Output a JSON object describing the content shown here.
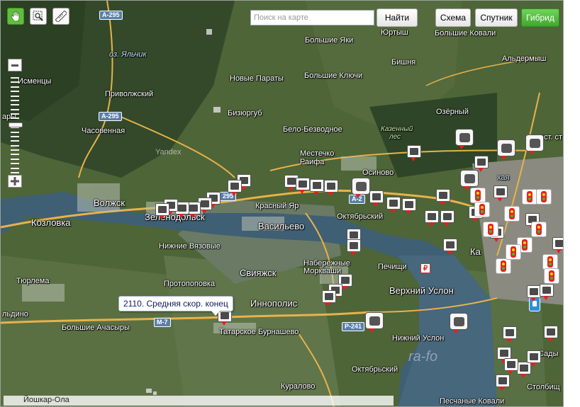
{
  "toolbar": {
    "tools": [
      {
        "name": "hand-tool",
        "icon": "hand-icon",
        "active": true
      },
      {
        "name": "magnifier-tool",
        "icon": "magnifier-icon",
        "active": false
      },
      {
        "name": "ruler-tool",
        "icon": "ruler-icon",
        "active": false
      }
    ]
  },
  "search": {
    "placeholder": "Поиск на карте",
    "value": "",
    "button_label": "Найти"
  },
  "map_types": [
    {
      "label": "Схема",
      "active": false
    },
    {
      "label": "Спутник",
      "active": false
    },
    {
      "label": "Гибрид",
      "active": true
    }
  ],
  "zoom": {
    "plus": "+",
    "minus": "−",
    "level_fraction": 0.5
  },
  "places": [
    {
      "id": "yurtysh",
      "text": "Юртыш"
    },
    {
      "id": "bolshie-kovali",
      "text": "Большие Ковали"
    },
    {
      "id": "bolshie-yaki",
      "text": "Большие Яки"
    },
    {
      "id": "bishnya",
      "text": "Бишня"
    },
    {
      "id": "aldermysh",
      "text": "Альдермыш"
    },
    {
      "id": "noviye-paraty",
      "text": "Новые Параты"
    },
    {
      "id": "bolshie-klyuchi",
      "text": "Большие Ключи"
    },
    {
      "id": "ismenzy",
      "text": "Исменцы"
    },
    {
      "id": "privolzhsky",
      "text": "Приволжский"
    },
    {
      "id": "ozyorny",
      "text": "Озёрный"
    },
    {
      "id": "bizyurgub",
      "text": "Бизюргуб"
    },
    {
      "id": "chasovennaya",
      "text": "Часовенная"
    },
    {
      "id": "belo-bezvodnoe",
      "text": "Бело-Безводное"
    },
    {
      "id": "mestechko-raifa",
      "text": "Местечко Раифа"
    },
    {
      "id": "osinovo",
      "text": "Осиново"
    },
    {
      "id": "volzhsk",
      "text": "Волжск"
    },
    {
      "id": "zelenodolsk",
      "text": "Зеленодольск"
    },
    {
      "id": "krasny-yar",
      "text": "Красный Яр"
    },
    {
      "id": "oktyabrsky",
      "text": "Октябрьский"
    },
    {
      "id": "kozlovka",
      "text": "Козловка"
    },
    {
      "id": "vasilevo",
      "text": "Васильево"
    },
    {
      "id": "nizhnie-vyazovye",
      "text": "Нижние Вязовые"
    },
    {
      "id": "naberezhnye-morkvashi",
      "text": "Набережные Моркваши"
    },
    {
      "id": "pechishi",
      "text": "Печищи"
    },
    {
      "id": "sviyazhsk",
      "text": "Свияжск"
    },
    {
      "id": "turlema",
      "text": "Тюрлема"
    },
    {
      "id": "protopopovka",
      "text": "Протопоповка"
    },
    {
      "id": "verkhny-uslon",
      "text": "Верхний Услон"
    },
    {
      "id": "innopolis",
      "text": "Иннополис"
    },
    {
      "id": "dino",
      "text": "льдино"
    },
    {
      "id": "bolshie-achasyry",
      "text": "Большие Ачасыры"
    },
    {
      "id": "tatarskoe-burnashevo",
      "text": "Татарское Бурнашево"
    },
    {
      "id": "nizhny-uslon",
      "text": "Нижний Услон"
    },
    {
      "id": "oktyabrsky-2",
      "text": "Октябрьский"
    },
    {
      "id": "kuralovo",
      "text": "Куралово"
    },
    {
      "id": "yoshkar-ola",
      "text": "Йошкар-Ола"
    },
    {
      "id": "pesochnye-kovali",
      "text": "Песчаные Ковали"
    },
    {
      "id": "stolbishe",
      "text": "Столбищ"
    },
    {
      "id": "sady",
      "text": "Сады"
    },
    {
      "id": "ost-st",
      "text": "ост. ст"
    },
    {
      "id": "ary",
      "text": "ары"
    },
    {
      "id": "kazan-k",
      "text": "Ка"
    },
    {
      "id": "ukhaya",
      "text": "хая"
    }
  ],
  "water_labels": [
    {
      "id": "yalchik",
      "text": "оз. Яльчик"
    }
  ],
  "forest_labels": [
    {
      "id": "kazenny-les",
      "text": "Казенный лес"
    }
  ],
  "road_shields": [
    {
      "id": "a295-top",
      "text": "А-295"
    },
    {
      "id": "a295-mid",
      "text": "А-295"
    },
    {
      "id": "r295",
      "text": "295"
    },
    {
      "id": "a-east",
      "text": "А-2"
    },
    {
      "id": "m7",
      "text": "М-7"
    },
    {
      "id": "r241",
      "text": "Р-241"
    }
  ],
  "watermarks": {
    "yandex": "Yandex",
    "site": "ra-fo"
  },
  "tooltip": {
    "text": "2110. Средняя скор. конец"
  },
  "metro_symbol": "₽",
  "colors": {
    "hybrid_active": "#4cb83a",
    "camera_arrow": "#e32020",
    "water": "#3f5f74",
    "road": "#e8b24a"
  }
}
